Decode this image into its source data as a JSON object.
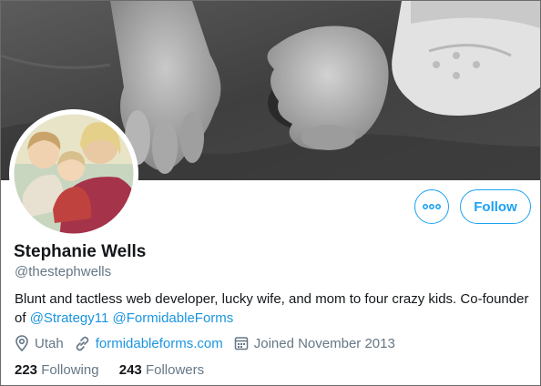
{
  "profile": {
    "name": "Stephanie Wells",
    "handle": "@thestephwells",
    "bio_text": "Blunt and tactless web developer, lucky wife, and mom to four crazy kids. Co-founder of",
    "bio_mention_1": "@Strategy11",
    "bio_mention_2": "@FormidableForms",
    "location": "Utah",
    "website": "formidableforms.com",
    "joined": "Joined November 2013"
  },
  "actions": {
    "follow_label": "Follow"
  },
  "stats": {
    "following_count": "223",
    "following_label": "Following",
    "followers_count": "243",
    "followers_label": "Followers"
  },
  "icons": {
    "location": "location-pin-icon",
    "website": "link-icon",
    "joined": "calendar-icon",
    "more": "more-dots-icon"
  },
  "colors": {
    "accent": "#1da1f2",
    "link": "#1b95e0",
    "secondary_text": "#657786",
    "primary_text": "#14171a"
  }
}
